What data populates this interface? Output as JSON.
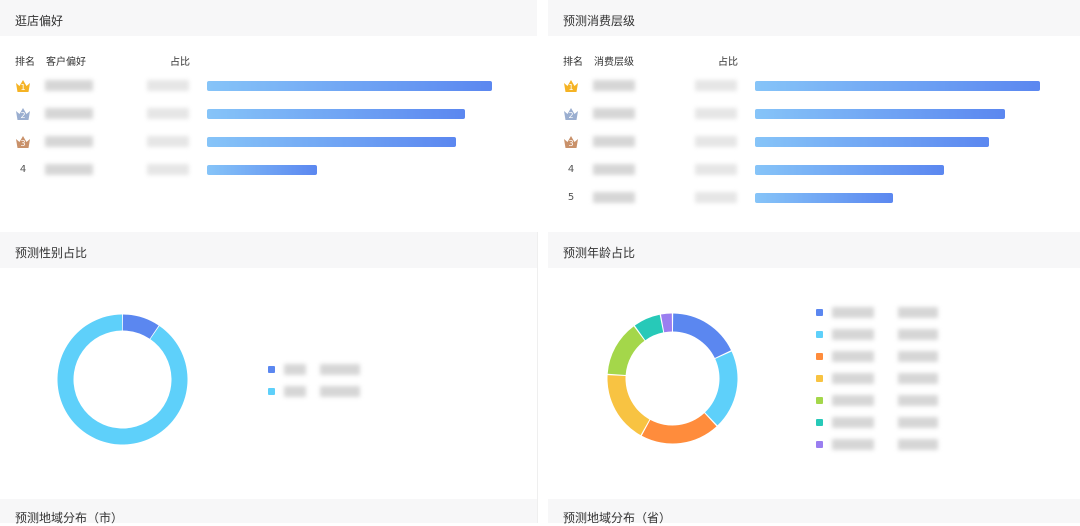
{
  "panels": {
    "store_pref": {
      "title": "逛店偏好",
      "col_rank": "排名",
      "col_pref": "客户偏好",
      "col_ratio": "占比"
    },
    "spend_level": {
      "title": "预测消费层级",
      "col_rank": "排名",
      "col_level": "消费层级",
      "col_ratio": "占比"
    },
    "gender": {
      "title": "预测性别占比"
    },
    "age": {
      "title": "预测年龄占比"
    },
    "region_city": {
      "title": "预测地域分布（市）"
    },
    "region_prov": {
      "title": "预测地域分布（省）"
    }
  },
  "icons": [
    "crown-gold-icon",
    "crown-silver-icon",
    "crown-bronze-icon"
  ],
  "colors": {
    "bar_start": "#86c4f8",
    "bar_end": "#5b87f0",
    "gender": [
      "#5b87f0",
      "#5ed0fa"
    ],
    "age": [
      "#5b87f0",
      "#5ed0fa",
      "#ff8c3c",
      "#f8c342",
      "#a4d74a",
      "#27c9b8",
      "#9a7ef0"
    ]
  },
  "chart_data": [
    {
      "type": "bar",
      "orientation": "horizontal",
      "title": "逛店偏好",
      "ranks": [
        "1",
        "2",
        "3",
        "4"
      ],
      "values": [
        100,
        90.6,
        87.4,
        38.5
      ],
      "xlim": [
        0,
        100
      ]
    },
    {
      "type": "bar",
      "orientation": "horizontal",
      "title": "预测消费层级",
      "ranks": [
        "1",
        "2",
        "3",
        "4",
        "5"
      ],
      "values": [
        100,
        87.7,
        82.1,
        66.3,
        48.4
      ],
      "xlim": [
        0,
        100
      ]
    },
    {
      "type": "pie",
      "style": "donut",
      "title": "预测性别占比",
      "values": [
        9.5,
        90.5
      ]
    },
    {
      "type": "pie",
      "style": "donut",
      "title": "预测年龄占比",
      "values": [
        18,
        20,
        20,
        18,
        14,
        7,
        3
      ]
    }
  ]
}
